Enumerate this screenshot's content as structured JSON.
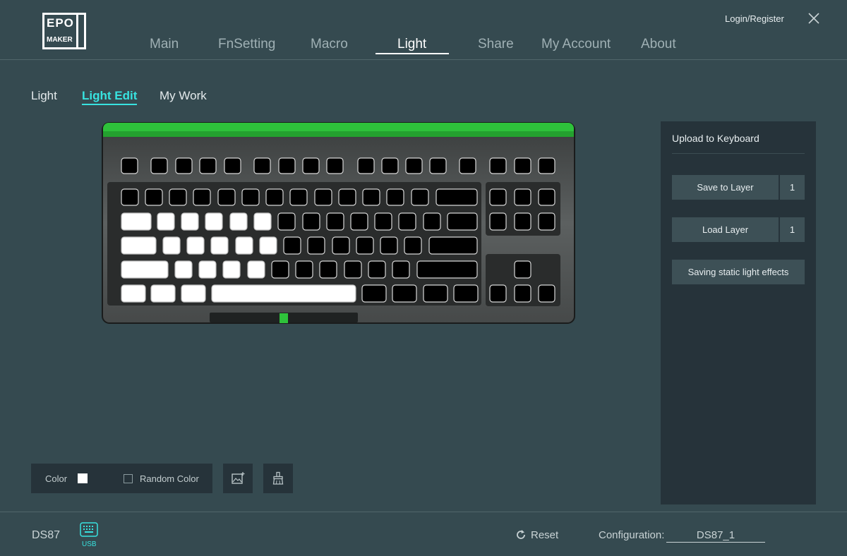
{
  "header": {
    "logo_line1": "EPO",
    "logo_line2": "MAKER",
    "logo_letter": "M",
    "login_label": "Login/Register",
    "nav": [
      {
        "label": "Main"
      },
      {
        "label": "FnSetting"
      },
      {
        "label": "Macro"
      },
      {
        "label": "Light",
        "active": true
      },
      {
        "label": "Share"
      },
      {
        "label": "My Account"
      },
      {
        "label": "About"
      }
    ]
  },
  "subtabs": [
    {
      "label": "Light"
    },
    {
      "label": "Light Edit",
      "active": true
    },
    {
      "label": "My Work"
    }
  ],
  "keyboard": {
    "accent_color": "#2ec23b",
    "lit_color": "#ffffff",
    "unlit_color": "#000000"
  },
  "right_panel": {
    "title": "Upload to Keyboard",
    "save_to_layer_label": "Save to Layer",
    "save_layer_value": "1",
    "load_layer_label": "Load Layer",
    "load_layer_value": "1",
    "save_static_label": "Saving static light effects"
  },
  "color_bar": {
    "color_label": "Color",
    "color_value": "#ffffff",
    "random_color_label": "Random Color",
    "random_checked": false,
    "tool_icons": [
      "image-add-icon",
      "brush-clear-icon"
    ]
  },
  "footer": {
    "model": "DS87",
    "connection": "USB",
    "reset_label": "Reset",
    "config_label": "Configuration:",
    "config_value": "DS87_1"
  }
}
